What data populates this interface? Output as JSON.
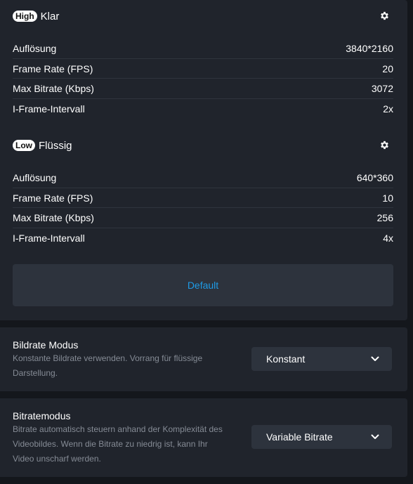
{
  "streams": [
    {
      "badge": "High",
      "title": "Klar",
      "icon": "gear-icon",
      "rows": [
        {
          "label": "Auflösung",
          "value": "3840*2160"
        },
        {
          "label": "Frame Rate (FPS)",
          "value": "20"
        },
        {
          "label": "Max Bitrate (Kbps)",
          "value": "3072"
        },
        {
          "label": "I-Frame-Intervall",
          "value": "2x"
        }
      ]
    },
    {
      "badge": "Low",
      "title": "Flüssig",
      "icon": "gear-icon",
      "rows": [
        {
          "label": "Auflösung",
          "value": "640*360"
        },
        {
          "label": "Frame Rate (FPS)",
          "value": "10"
        },
        {
          "label": "Max Bitrate (Kbps)",
          "value": "256"
        },
        {
          "label": "I-Frame-Intervall",
          "value": "4x"
        }
      ]
    }
  ],
  "default_button": "Default",
  "bitrate_mode": {
    "title": "Bildrate Modus",
    "description": "Konstante Bildrate verwenden. Vorrang für flüssige Darstellung.",
    "selected": "Konstant"
  },
  "bitrate_control": {
    "title": "Bitratemodus",
    "description": "Bitrate automatisch steuern anhand der Komplexität des Videobildes. Wenn die Bitrate zu niedrig ist, kann Ihr Video unscharf werden.",
    "selected": "Variable Bitrate"
  },
  "colors": {
    "background": "#14171c",
    "card": "#20242c",
    "control": "#2d333d",
    "accent": "#1e9be6",
    "muted_text": "#858b95"
  }
}
